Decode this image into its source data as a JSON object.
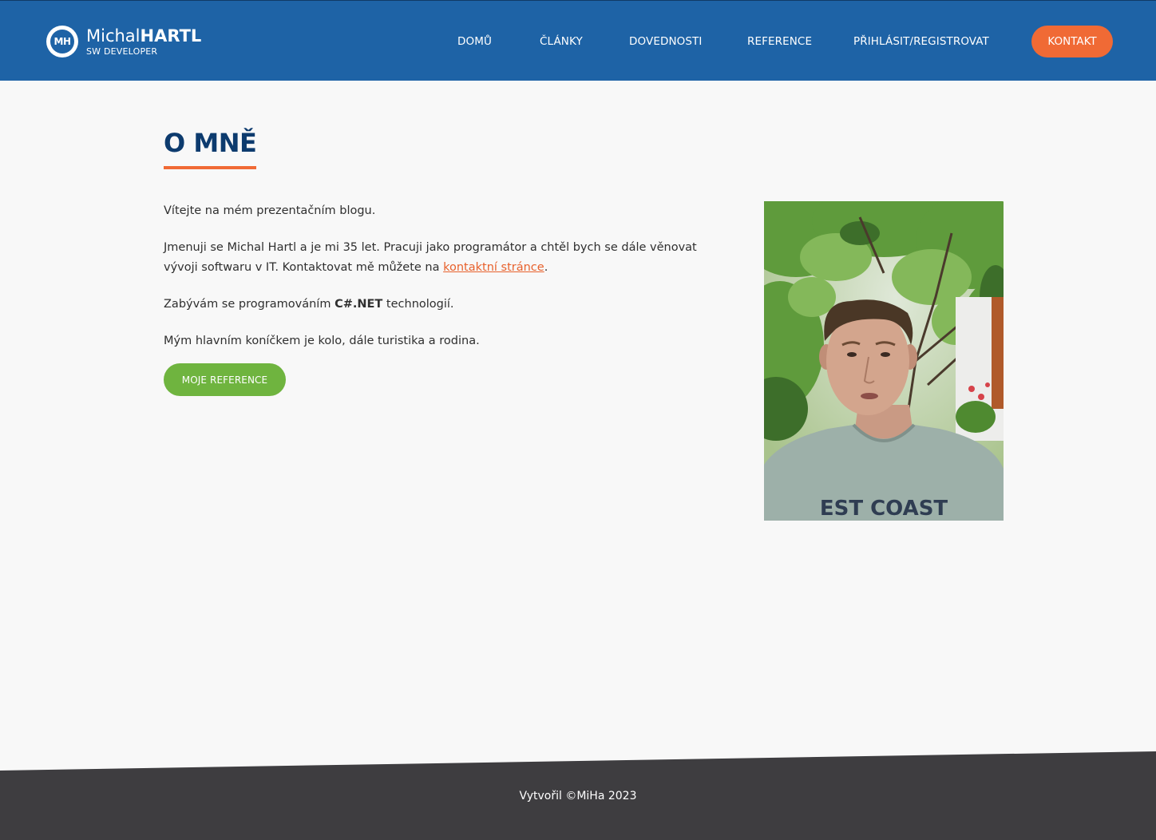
{
  "header": {
    "logo": {
      "initials": "MH",
      "first_name": "Michal",
      "last_name": "HARTL",
      "subtitle": "SW DEVELOPER"
    },
    "nav": [
      {
        "label": "DOMŮ"
      },
      {
        "label": "ČLÁNKY"
      },
      {
        "label": "DOVEDNOSTI"
      },
      {
        "label": "REFERENCE"
      },
      {
        "label": "PŘIHLÁSIT/REGISTROVAT"
      }
    ],
    "contact_label": "KONTAKT"
  },
  "main": {
    "title": "O MNĚ",
    "paragraphs": {
      "welcome": "Vítejte na mém prezentačním blogu.",
      "intro_before_link": "Jmenuji se Michal Hartl a je mi 35 let. Pracuji jako programátor a chtěl bych se dále věnovat vývoji softwaru v IT. Kontaktovat mě můžete na ",
      "intro_link": "kontaktní stránce",
      "intro_after_link": ".",
      "tech_before": "Zabývám se programováním ",
      "tech_bold": "C#.NET",
      "tech_after": " technologií.",
      "hobby": "Mým hlavním koníčkem je kolo, dále turistika a rodina."
    },
    "button_label": "MOJE REFERENCE",
    "portrait_shirt_text": "EST COAST"
  },
  "footer": {
    "text": "Vytvořil ©MiHa 2023"
  },
  "colors": {
    "header_bg": "#1e63a6",
    "accent_orange": "#f06a35",
    "title_navy": "#0d3b6e",
    "button_green": "#6fb43f",
    "footer_bg": "#3e3d40",
    "page_bg": "#f8f8f8"
  }
}
